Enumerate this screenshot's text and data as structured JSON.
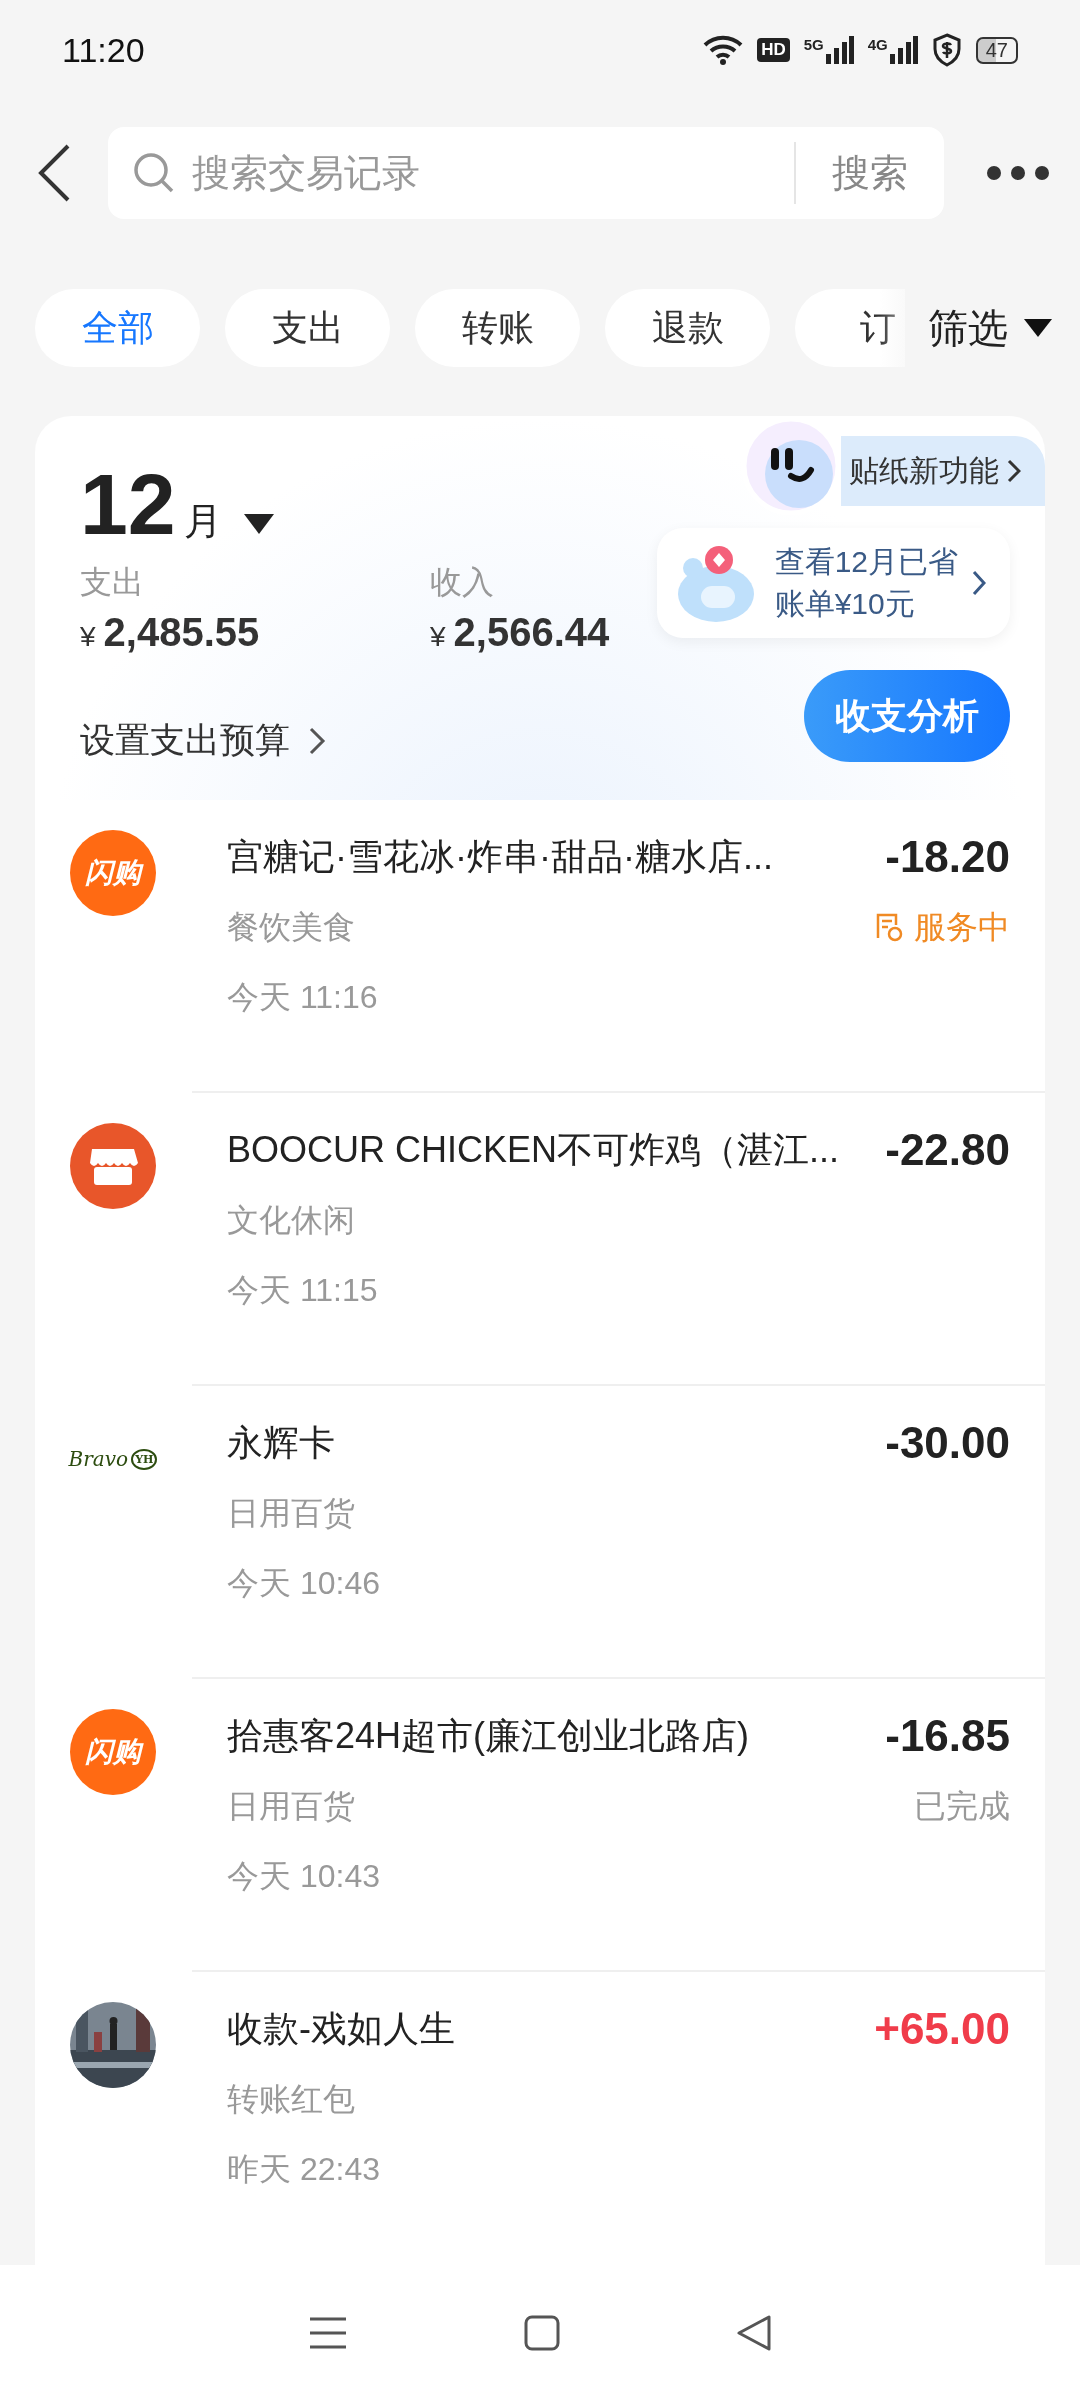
{
  "status_bar": {
    "time": "11:20",
    "hd": "HD",
    "networks": [
      "5G",
      "4G"
    ],
    "battery": "47"
  },
  "search": {
    "placeholder": "搜索交易记录",
    "button": "搜索"
  },
  "tabs": [
    {
      "label": "全部",
      "selected": true
    },
    {
      "label": "支出",
      "selected": false
    },
    {
      "label": "转账",
      "selected": false
    },
    {
      "label": "退款",
      "selected": false
    },
    {
      "label": "订",
      "selected": false
    }
  ],
  "filter": "筛选",
  "summary": {
    "month": "12",
    "month_unit": "月",
    "expense_label": "支出",
    "expense_currency": "¥",
    "expense": "2,485.55",
    "income_label": "收入",
    "income_currency": "¥",
    "income": "2,566.44",
    "budget_link": "设置支出预算",
    "sticker_promo": "贴纸新功能",
    "savings_tip": [
      "查看12月已省",
      "账单¥10元"
    ],
    "analysis_button": "收支分析"
  },
  "transactions": [
    {
      "logo": {
        "kind": "flash",
        "text": "闪购"
      },
      "title": "宫糖记·雪花冰·炸串·甜品·糖水店...",
      "category": "餐饮美食",
      "time": "今天 11:16",
      "amount": "-18.20",
      "income": false,
      "status": {
        "kind": "in_service",
        "text": "服务中"
      }
    },
    {
      "logo": {
        "kind": "store"
      },
      "title": "BOOCUR CHICKEN不可炸鸡（湛江...",
      "category": "文化休闲",
      "time": "今天 11:15",
      "amount": "-22.80",
      "income": false
    },
    {
      "logo": {
        "kind": "bravo",
        "text": "Bravo",
        "badge": "YH"
      },
      "title": "永辉卡",
      "category": "日用百货",
      "time": "今天 10:46",
      "amount": "-30.00",
      "income": false
    },
    {
      "logo": {
        "kind": "flash",
        "text": "闪购"
      },
      "title": "拾惠客24H超市(廉江创业北路店)",
      "category": "日用百货",
      "time": "今天 10:43",
      "amount": "-16.85",
      "income": false,
      "status": {
        "kind": "done",
        "text": "已完成"
      }
    },
    {
      "title": "收款-戏如人生",
      "category": "转账红包",
      "time": "昨天 22:43",
      "amount": "+65.00",
      "income": true
    }
  ]
}
